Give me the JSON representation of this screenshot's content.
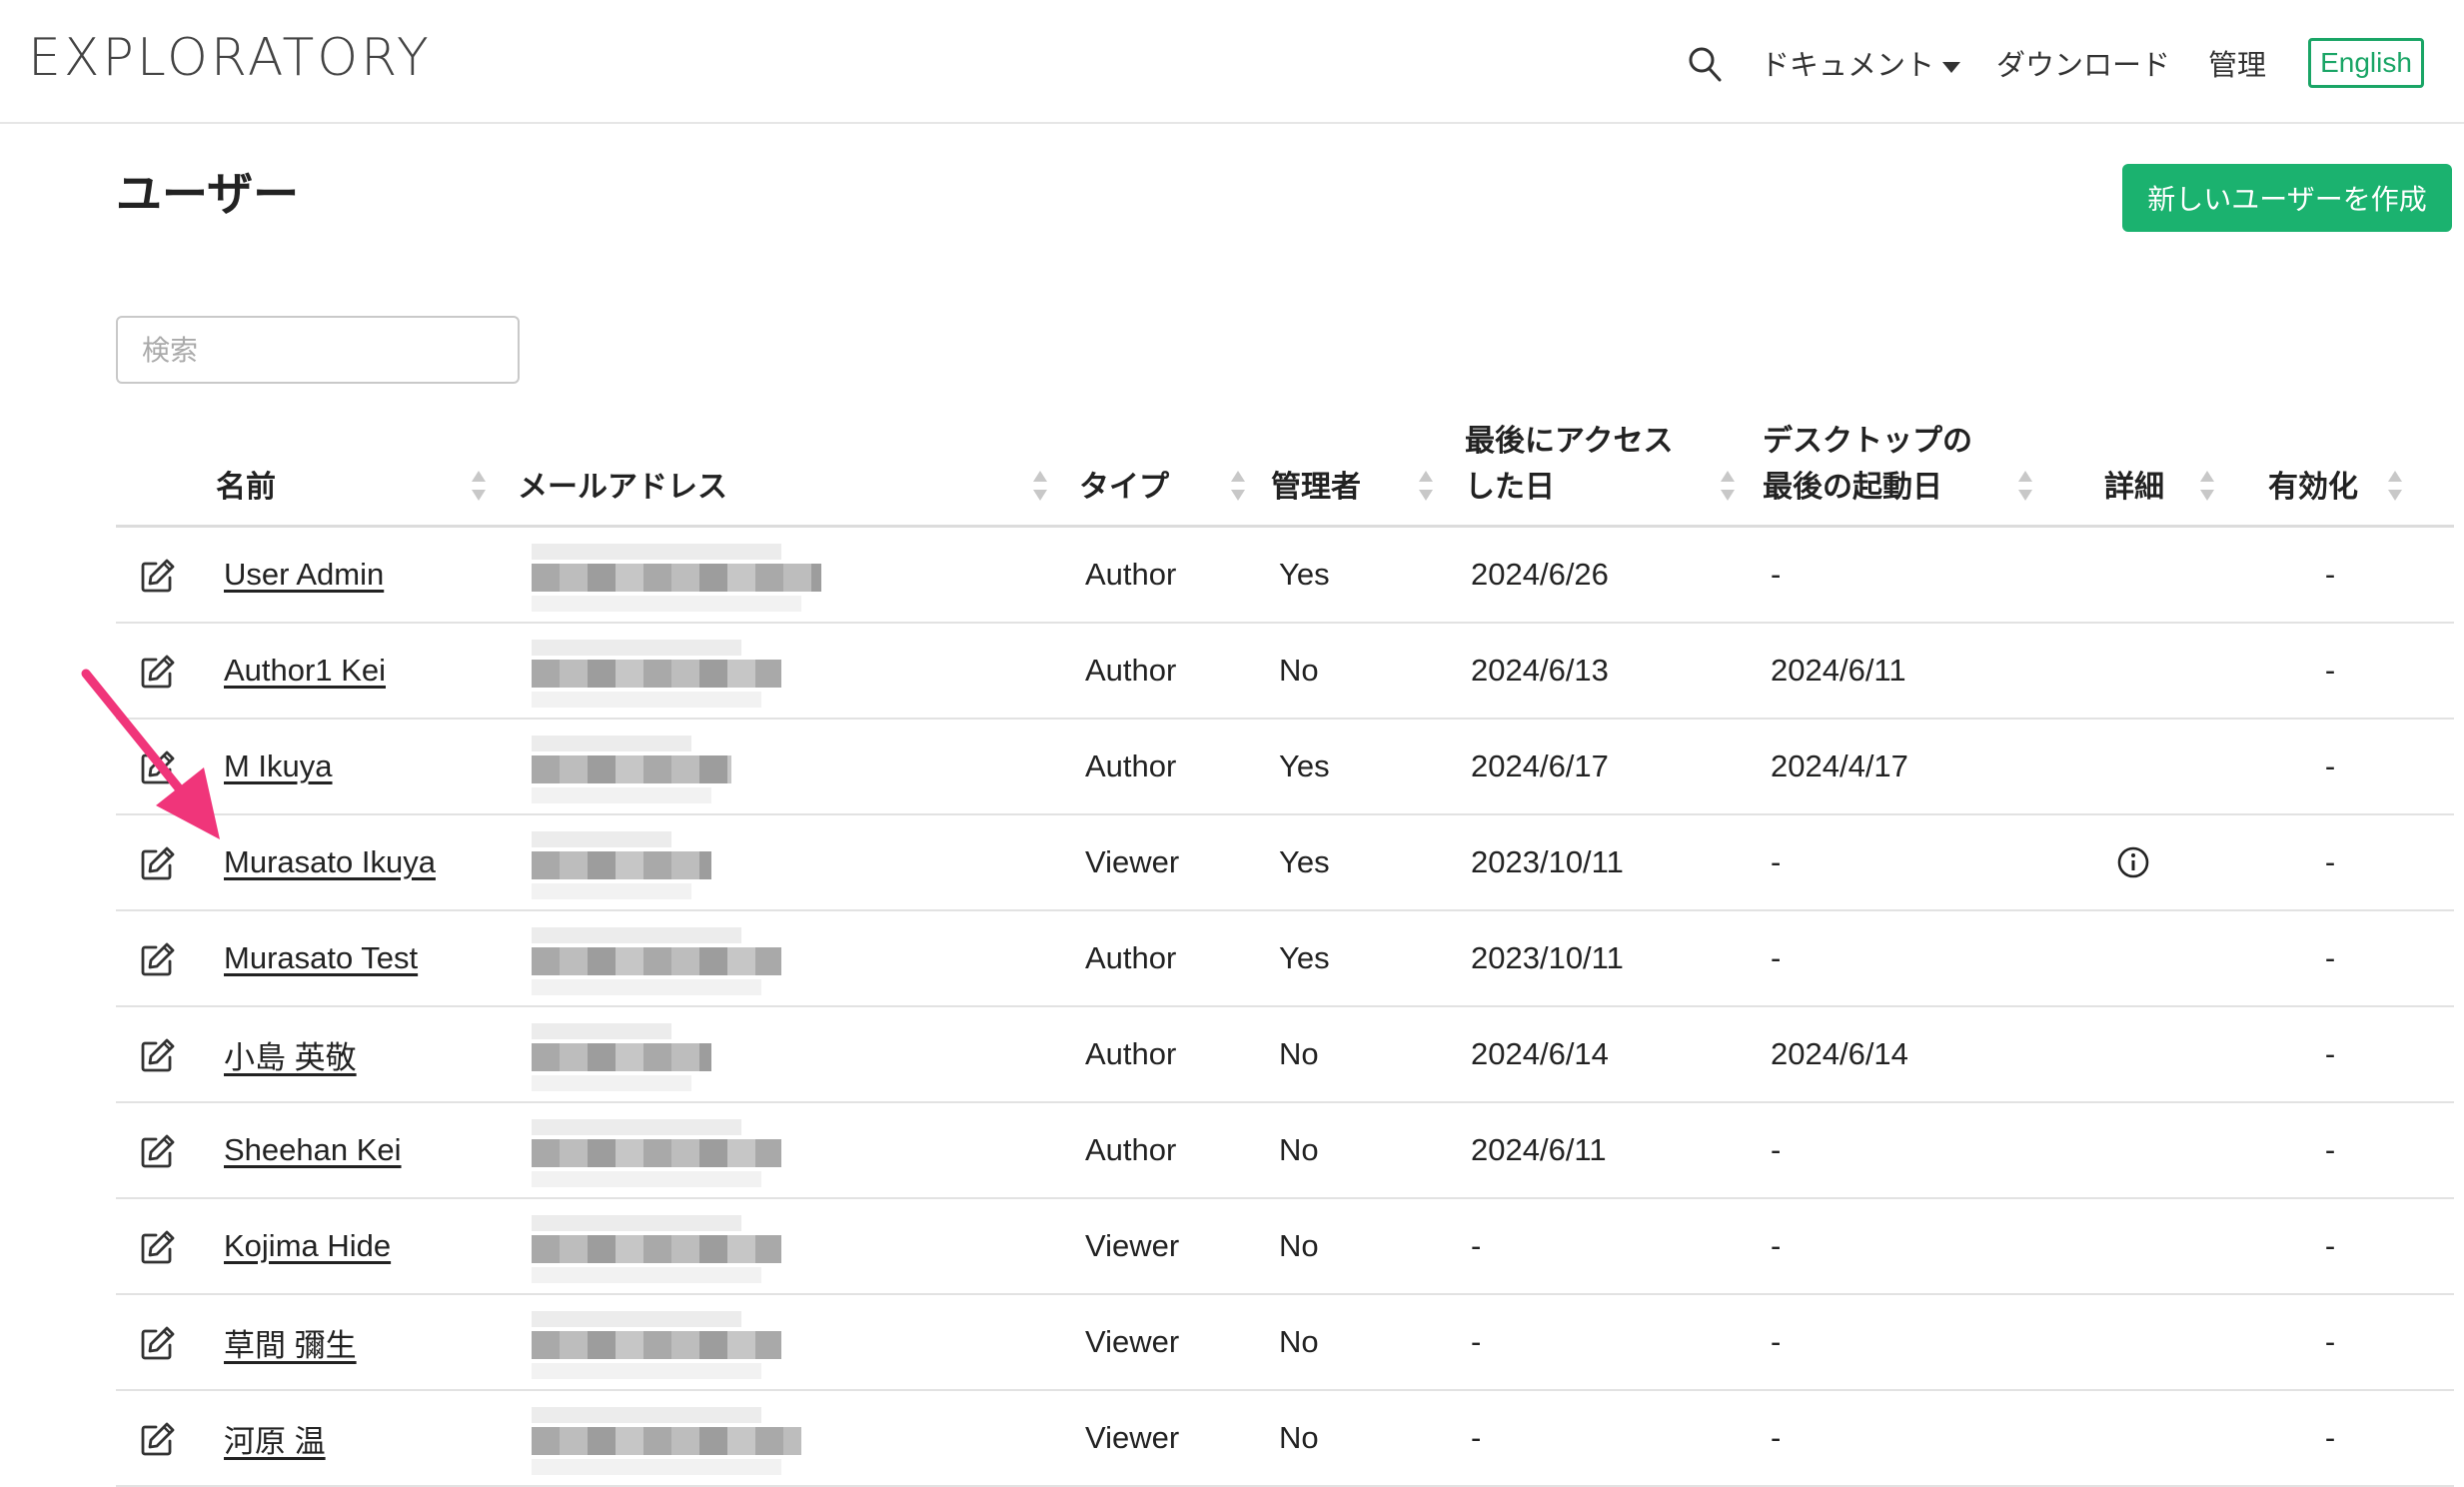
{
  "navbar": {
    "logo": "EXPLORATORY",
    "docs_label": "ドキュメント",
    "download_label": "ダウンロード",
    "admin_label": "管理",
    "language_label": "English"
  },
  "page": {
    "title": "ユーザー",
    "create_button": "新しいユーザーを作成",
    "search_placeholder": "検索"
  },
  "table": {
    "columns": {
      "name": "名前",
      "email": "メールアドレス",
      "type": "タイプ",
      "admin": "管理者",
      "last_access_line1": "最後にアクセス",
      "last_access_line2": "した日",
      "desktop_line1": "デスクトップの",
      "desktop_line2": "最後の起動日",
      "details": "詳細",
      "enabled": "有効化"
    },
    "rows": [
      {
        "name": "User Admin",
        "type": "Author",
        "admin": "Yes",
        "last_access": "2024/6/26",
        "desktop": "-",
        "details": "",
        "enabled": "-"
      },
      {
        "name": "Author1 Kei",
        "type": "Author",
        "admin": "No",
        "last_access": "2024/6/13",
        "desktop": "2024/6/11",
        "details": "",
        "enabled": "-"
      },
      {
        "name": "M Ikuya",
        "type": "Author",
        "admin": "Yes",
        "last_access": "2024/6/17",
        "desktop": "2024/4/17",
        "details": "",
        "enabled": "-"
      },
      {
        "name": "Murasato Ikuya",
        "type": "Viewer",
        "admin": "Yes",
        "last_access": "2023/10/11",
        "desktop": "-",
        "details": "info-icon",
        "enabled": "-"
      },
      {
        "name": "Murasato Test",
        "type": "Author",
        "admin": "Yes",
        "last_access": "2023/10/11",
        "desktop": "-",
        "details": "",
        "enabled": "-"
      },
      {
        "name": "小島 英敬",
        "type": "Author",
        "admin": "No",
        "last_access": "2024/6/14",
        "desktop": "2024/6/14",
        "details": "",
        "enabled": "-"
      },
      {
        "name": "Sheehan Kei",
        "type": "Author",
        "admin": "No",
        "last_access": "2024/6/11",
        "desktop": "-",
        "details": "",
        "enabled": "-"
      },
      {
        "name": "Kojima Hide",
        "type": "Viewer",
        "admin": "No",
        "last_access": "-",
        "desktop": "-",
        "details": "",
        "enabled": "-"
      },
      {
        "name": "草間 彌生",
        "type": "Viewer",
        "admin": "No",
        "last_access": "-",
        "desktop": "-",
        "details": "",
        "enabled": "-"
      },
      {
        "name": "河原 温",
        "type": "Viewer",
        "admin": "No",
        "last_access": "-",
        "desktop": "-",
        "details": "",
        "enabled": "-"
      }
    ]
  },
  "colors": {
    "accent": "#1bb26f",
    "annotation_arrow": "#f0357a"
  },
  "icons": [
    "search-icon",
    "caret-down-icon",
    "edit-icon",
    "info-icon",
    "sort-icon",
    "arrow-annotation-icon"
  ]
}
